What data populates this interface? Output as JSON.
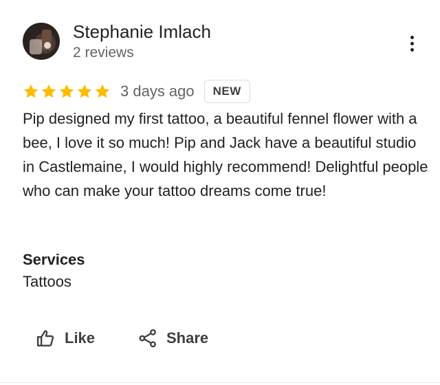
{
  "reviewer": {
    "name": "Stephanie Imlach",
    "reviews_count": "2 reviews"
  },
  "review": {
    "rating": 5,
    "rating_max": 5,
    "time": "3 days ago",
    "badge": "NEW",
    "text": "Pip designed my first tattoo, a beautiful fennel flower with a bee, I love it so much! Pip and Jack have a beautiful studio in Castlemaine, I would highly recommend! Delightful people who can make your tattoo dreams come true!"
  },
  "services": {
    "title": "Services",
    "value": "Tattoos"
  },
  "actions": {
    "like": "Like",
    "share": "Share"
  },
  "colors": {
    "star": "#fbbc04",
    "text_primary": "#202124",
    "text_secondary": "#5f6368"
  },
  "icons": {
    "more": "more-vert-icon",
    "like": "thumb-up-icon",
    "share": "share-icon",
    "star": "star-icon"
  }
}
